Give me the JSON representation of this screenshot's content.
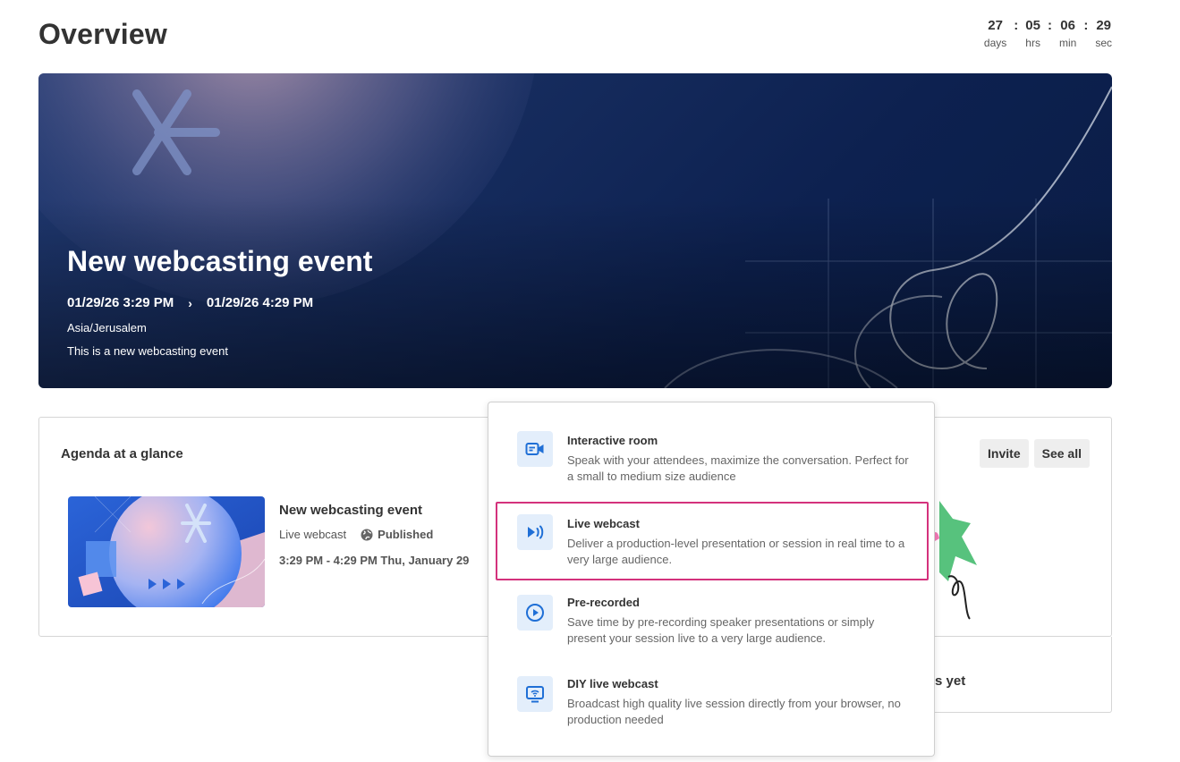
{
  "page": {
    "title": "Overview"
  },
  "countdown": {
    "days": "27",
    "days_label": "days",
    "hrs": "05",
    "hrs_label": "hrs",
    "min": "06",
    "min_label": "min",
    "sec": "29",
    "sec_label": "sec",
    "separator": ":"
  },
  "hero": {
    "title": "New webcasting event",
    "start": "01/29/26 3:29 PM",
    "arrow": "›",
    "end": "01/29/26 4:29 PM",
    "timezone": "Asia/Jerusalem",
    "description": "This is a new webcasting event"
  },
  "agenda": {
    "title": "Agenda at a glance",
    "invite_label": "Invite",
    "see_all_label": "See all",
    "session": {
      "title": "New webcasting event",
      "type": "Live webcast",
      "status": "Published",
      "time": "3:29 PM - 4:29 PM Thu, January 29"
    }
  },
  "right_card": {
    "text_fragment": "s yet"
  },
  "session_types": [
    {
      "title": "Interactive room",
      "description": "Speak with your attendees, maximize the conversation. Perfect for a small to medium size audience",
      "icon": "video-chat-icon"
    },
    {
      "title": "Live webcast",
      "description": "Deliver a production-level presentation or session in real time to a very large audience.",
      "icon": "broadcast-icon",
      "selected": true
    },
    {
      "title": "Pre-recorded",
      "description": "Save time by pre-recording speaker presentations or simply present your session live to a very large audience.",
      "icon": "play-circle-icon"
    },
    {
      "title": "DIY live webcast",
      "description": "Broadcast high quality live session directly from your browser, no production needed",
      "icon": "screen-cast-icon"
    }
  ],
  "colors": {
    "selected_border": "#d4327c",
    "icon_bg": "#e3eefb",
    "icon_fg": "#1f6fd6"
  }
}
